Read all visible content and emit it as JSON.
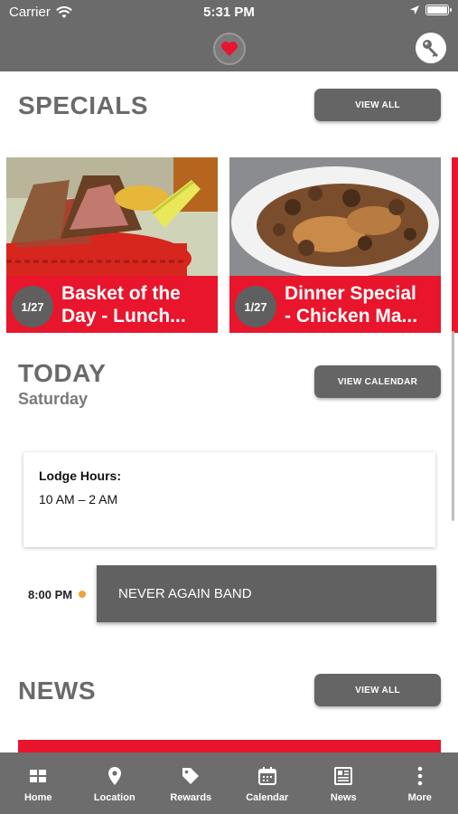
{
  "status_bar": {
    "carrier": "Carrier",
    "time": "5:31 PM"
  },
  "specials": {
    "title": "SPECIALS",
    "view_all": "VIEW ALL",
    "cards": [
      {
        "badge": "1/27",
        "title": "Basket of the\nDay - Lunch..."
      },
      {
        "badge": "1/27",
        "title": "Dinner Special\n- Chicken Ma..."
      }
    ]
  },
  "today": {
    "title": "TODAY",
    "day": "Saturday",
    "view_calendar": "VIEW CALENDAR",
    "hours_label": "Lodge Hours:",
    "hours_value": "10 AM – 2 AM",
    "event_time": "8:00 PM",
    "event_name": "NEVER AGAIN BAND"
  },
  "news": {
    "title": "NEWS",
    "view_all": "VIEW ALL"
  },
  "tabs": [
    {
      "label": "Home",
      "icon": "home-grid-icon"
    },
    {
      "label": "Location",
      "icon": "map-pin-icon"
    },
    {
      "label": "Rewards",
      "icon": "tag-icon"
    },
    {
      "label": "Calendar",
      "icon": "calendar-icon"
    },
    {
      "label": "News",
      "icon": "newspaper-icon"
    },
    {
      "label": "More",
      "icon": "more-vertical-icon"
    }
  ],
  "colors": {
    "header": "#6b6b6b",
    "accent_red": "#e8152c",
    "button_gray": "#656565",
    "event_dot": "#f2a03a"
  }
}
